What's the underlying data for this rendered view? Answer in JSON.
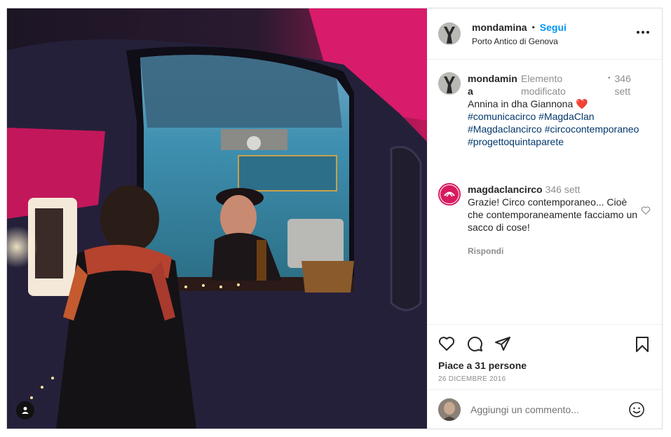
{
  "header": {
    "username": "mondamina",
    "separator": "•",
    "follow_label": "Segui",
    "location": "Porto Antico di Genova",
    "more_icon": "more-horizontal-icon"
  },
  "caption": {
    "username_line1": "mondamin",
    "username_line2": "a",
    "edited_line1": "Elemento",
    "edited_line2": "modificato",
    "separator": "•",
    "time_line1": "346",
    "time_line2": "sett",
    "text": "Annina in dha Giannona ❤️",
    "hashtags_line1": "#comunicacirco #MagdaClan",
    "hashtags_line2": "#Magdaclancirco #circocontemporaneo",
    "hashtags_line3": "#progettoquintaparete"
  },
  "comment": {
    "username": "magdaclancirco",
    "time": "346 sett",
    "text": "Grazie! Circo contemporaneo... Cioè che contemporaneamente facciamo un sacco di cose!",
    "reply_label": "Rispondi"
  },
  "actions": {
    "likes": "Piace a 31 persone",
    "date": "26 DICEMBRE 2016"
  },
  "add_comment": {
    "placeholder": "Aggiungi un commento..."
  },
  "colors": {
    "follow": "#0095f6",
    "hashtag": "#00376b",
    "muted": "#8e8e8e",
    "border": "#dbdbdb"
  }
}
